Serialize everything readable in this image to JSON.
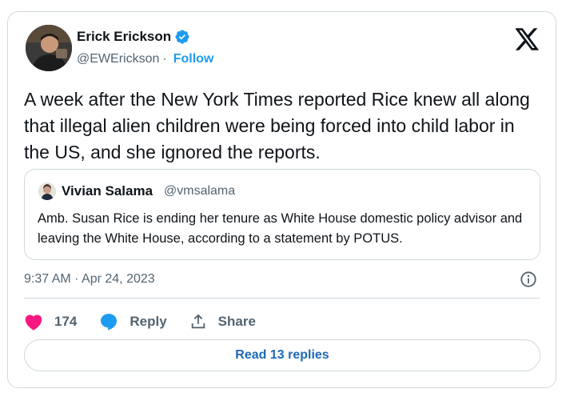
{
  "author": {
    "display_name": "Erick Erickson",
    "handle": "@EWErickson",
    "separator": "·",
    "follow_label": "Follow"
  },
  "tweet": {
    "text": "A week after the New York Times reported Rice knew all along that illegal alien children were being forced into child labor in the US, and she ignored the reports.",
    "timestamp": "9:37 AM · Apr 24, 2023"
  },
  "quoted_tweet": {
    "display_name": "Vivian Salama",
    "handle": "@vmsalama",
    "text": "Amb. Susan Rice is ending her tenure as White House domestic policy advisor and leaving the White House, according to a statement by POTUS."
  },
  "actions": {
    "like_count": "174",
    "reply_label": "Reply",
    "share_label": "Share",
    "read_replies_label": "Read 13 replies"
  },
  "colors": {
    "accent": "#1d9bf0",
    "like": "#f91880",
    "text": "#0f1419",
    "muted": "#536471",
    "border": "#cfd9de"
  },
  "icons": [
    "verified-badge-icon",
    "x-logo-icon",
    "info-icon",
    "heart-icon",
    "reply-bubble-icon",
    "share-icon"
  ]
}
